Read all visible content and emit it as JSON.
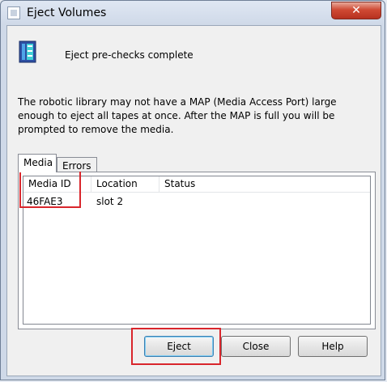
{
  "window": {
    "title": "Eject Volumes",
    "close_glyph": "✕"
  },
  "header": {
    "text": "Eject pre-checks complete",
    "icon": "tape-library-icon"
  },
  "message": "The robotic library may not have a MAP (Media Access Port) large enough to eject all tapes at once.  After the MAP is full you will be prompted to remove the media.",
  "tabs": [
    {
      "label": "Media"
    },
    {
      "label": "Errors"
    }
  ],
  "table": {
    "columns": [
      "Media ID",
      "Location",
      "Status"
    ],
    "rows": [
      {
        "media_id": "46FAE3",
        "location": "slot 2",
        "status": ""
      }
    ]
  },
  "buttons": {
    "eject": "Eject",
    "close": "Close",
    "help": "Help"
  },
  "colors": {
    "highlight": "#d9262c",
    "close_button": "#c8412c"
  }
}
